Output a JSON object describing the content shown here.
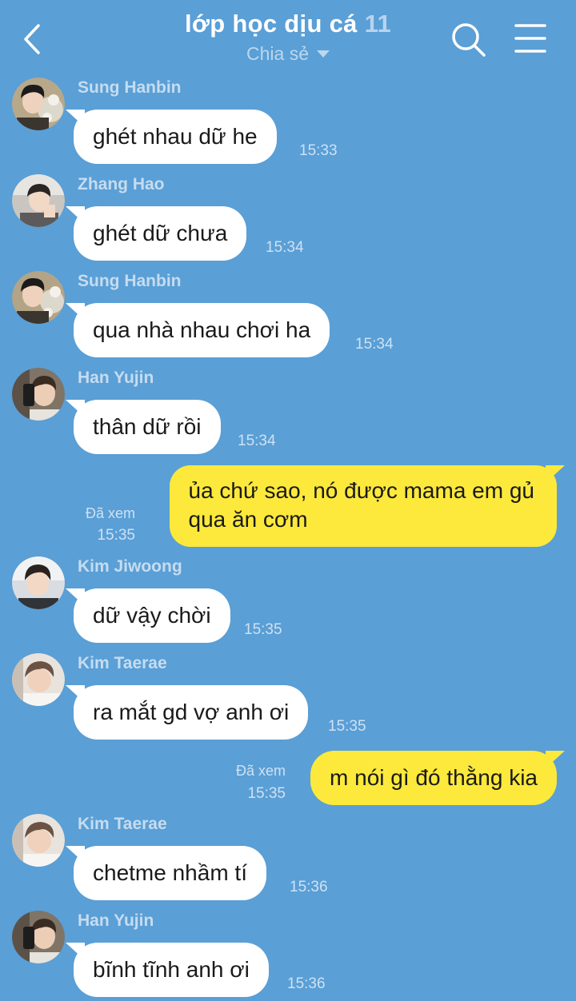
{
  "header": {
    "title": "lớp học dịu cá",
    "member_count": "11",
    "subtitle": "Chia sẻ",
    "back_icon": "chevron-left-icon",
    "search_icon": "search-icon",
    "menu_icon": "hamburger-menu-icon"
  },
  "colors": {
    "background": "#5a9fd6",
    "incoming_bubble": "#ffffff",
    "outgoing_bubble": "#fde93b"
  },
  "messages": [
    {
      "sender": "Sung Hanbin",
      "text": "ghét nhau dữ he",
      "time": "15:33"
    },
    {
      "sender": "Zhang Hao",
      "text": "ghét dữ chưa",
      "time": "15:34"
    },
    {
      "sender": "Sung Hanbin",
      "text": "qua nhà nhau chơi ha",
      "time": "15:34"
    },
    {
      "sender": "Han Yujin",
      "text": "thân dữ rồi",
      "time": "15:34"
    },
    {
      "outgoing": true,
      "line1": "ủa chứ sao, nó được mama em gủ",
      "line2": "qua ăn cơm",
      "status": "Đã xem",
      "time": "15:35"
    },
    {
      "sender": "Kim Jiwoong",
      "text": "dữ vậy chời",
      "time": "15:35"
    },
    {
      "sender": "Kim Taerae",
      "text": "ra mắt gd vợ anh ơi",
      "time": "15:35"
    },
    {
      "outgoing": true,
      "text": "m nói gì đó thằng kia",
      "status": "Đã xem",
      "time": "15:35"
    },
    {
      "sender": "Kim Taerae",
      "text": "chetme nhầm tí",
      "time": "15:36"
    },
    {
      "sender": "Han Yujin",
      "text": "bĩnh tĩnh anh ơi",
      "time": "15:36"
    }
  ]
}
